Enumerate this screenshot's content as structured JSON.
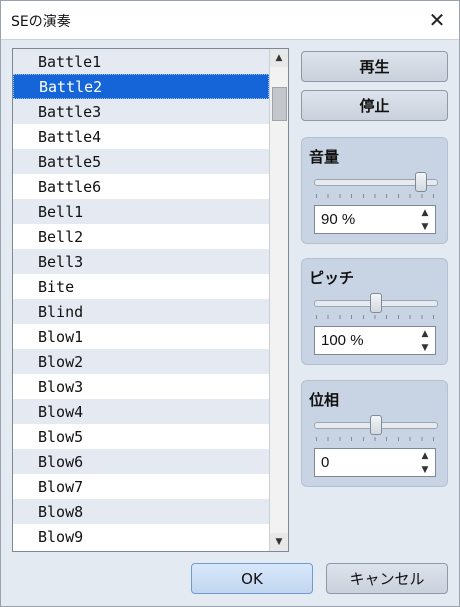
{
  "window": {
    "title": "SEの演奏",
    "close_icon": "close-icon"
  },
  "list": {
    "items": [
      "Battle1",
      "Battle2",
      "Battle3",
      "Battle4",
      "Battle5",
      "Battle6",
      "Bell1",
      "Bell2",
      "Bell3",
      "Bite",
      "Blind",
      "Blow1",
      "Blow2",
      "Blow3",
      "Blow4",
      "Blow5",
      "Blow6",
      "Blow7",
      "Blow8",
      "Blow9"
    ],
    "selected_index": 1,
    "scroll_position": 0.05
  },
  "buttons": {
    "play": "再生",
    "stop": "停止",
    "ok": "OK",
    "cancel": "キャンセル"
  },
  "volume": {
    "label": "音量",
    "value": "90 %",
    "level": 0.9
  },
  "pitch": {
    "label": "ピッチ",
    "value": "100 %",
    "level": 0.5
  },
  "pan": {
    "label": "位相",
    "value": "0",
    "level": 0.5
  },
  "colors": {
    "selection": "#1565d8",
    "group_bg": "#c8d4e4",
    "alt_row": "#e5eaf2"
  }
}
